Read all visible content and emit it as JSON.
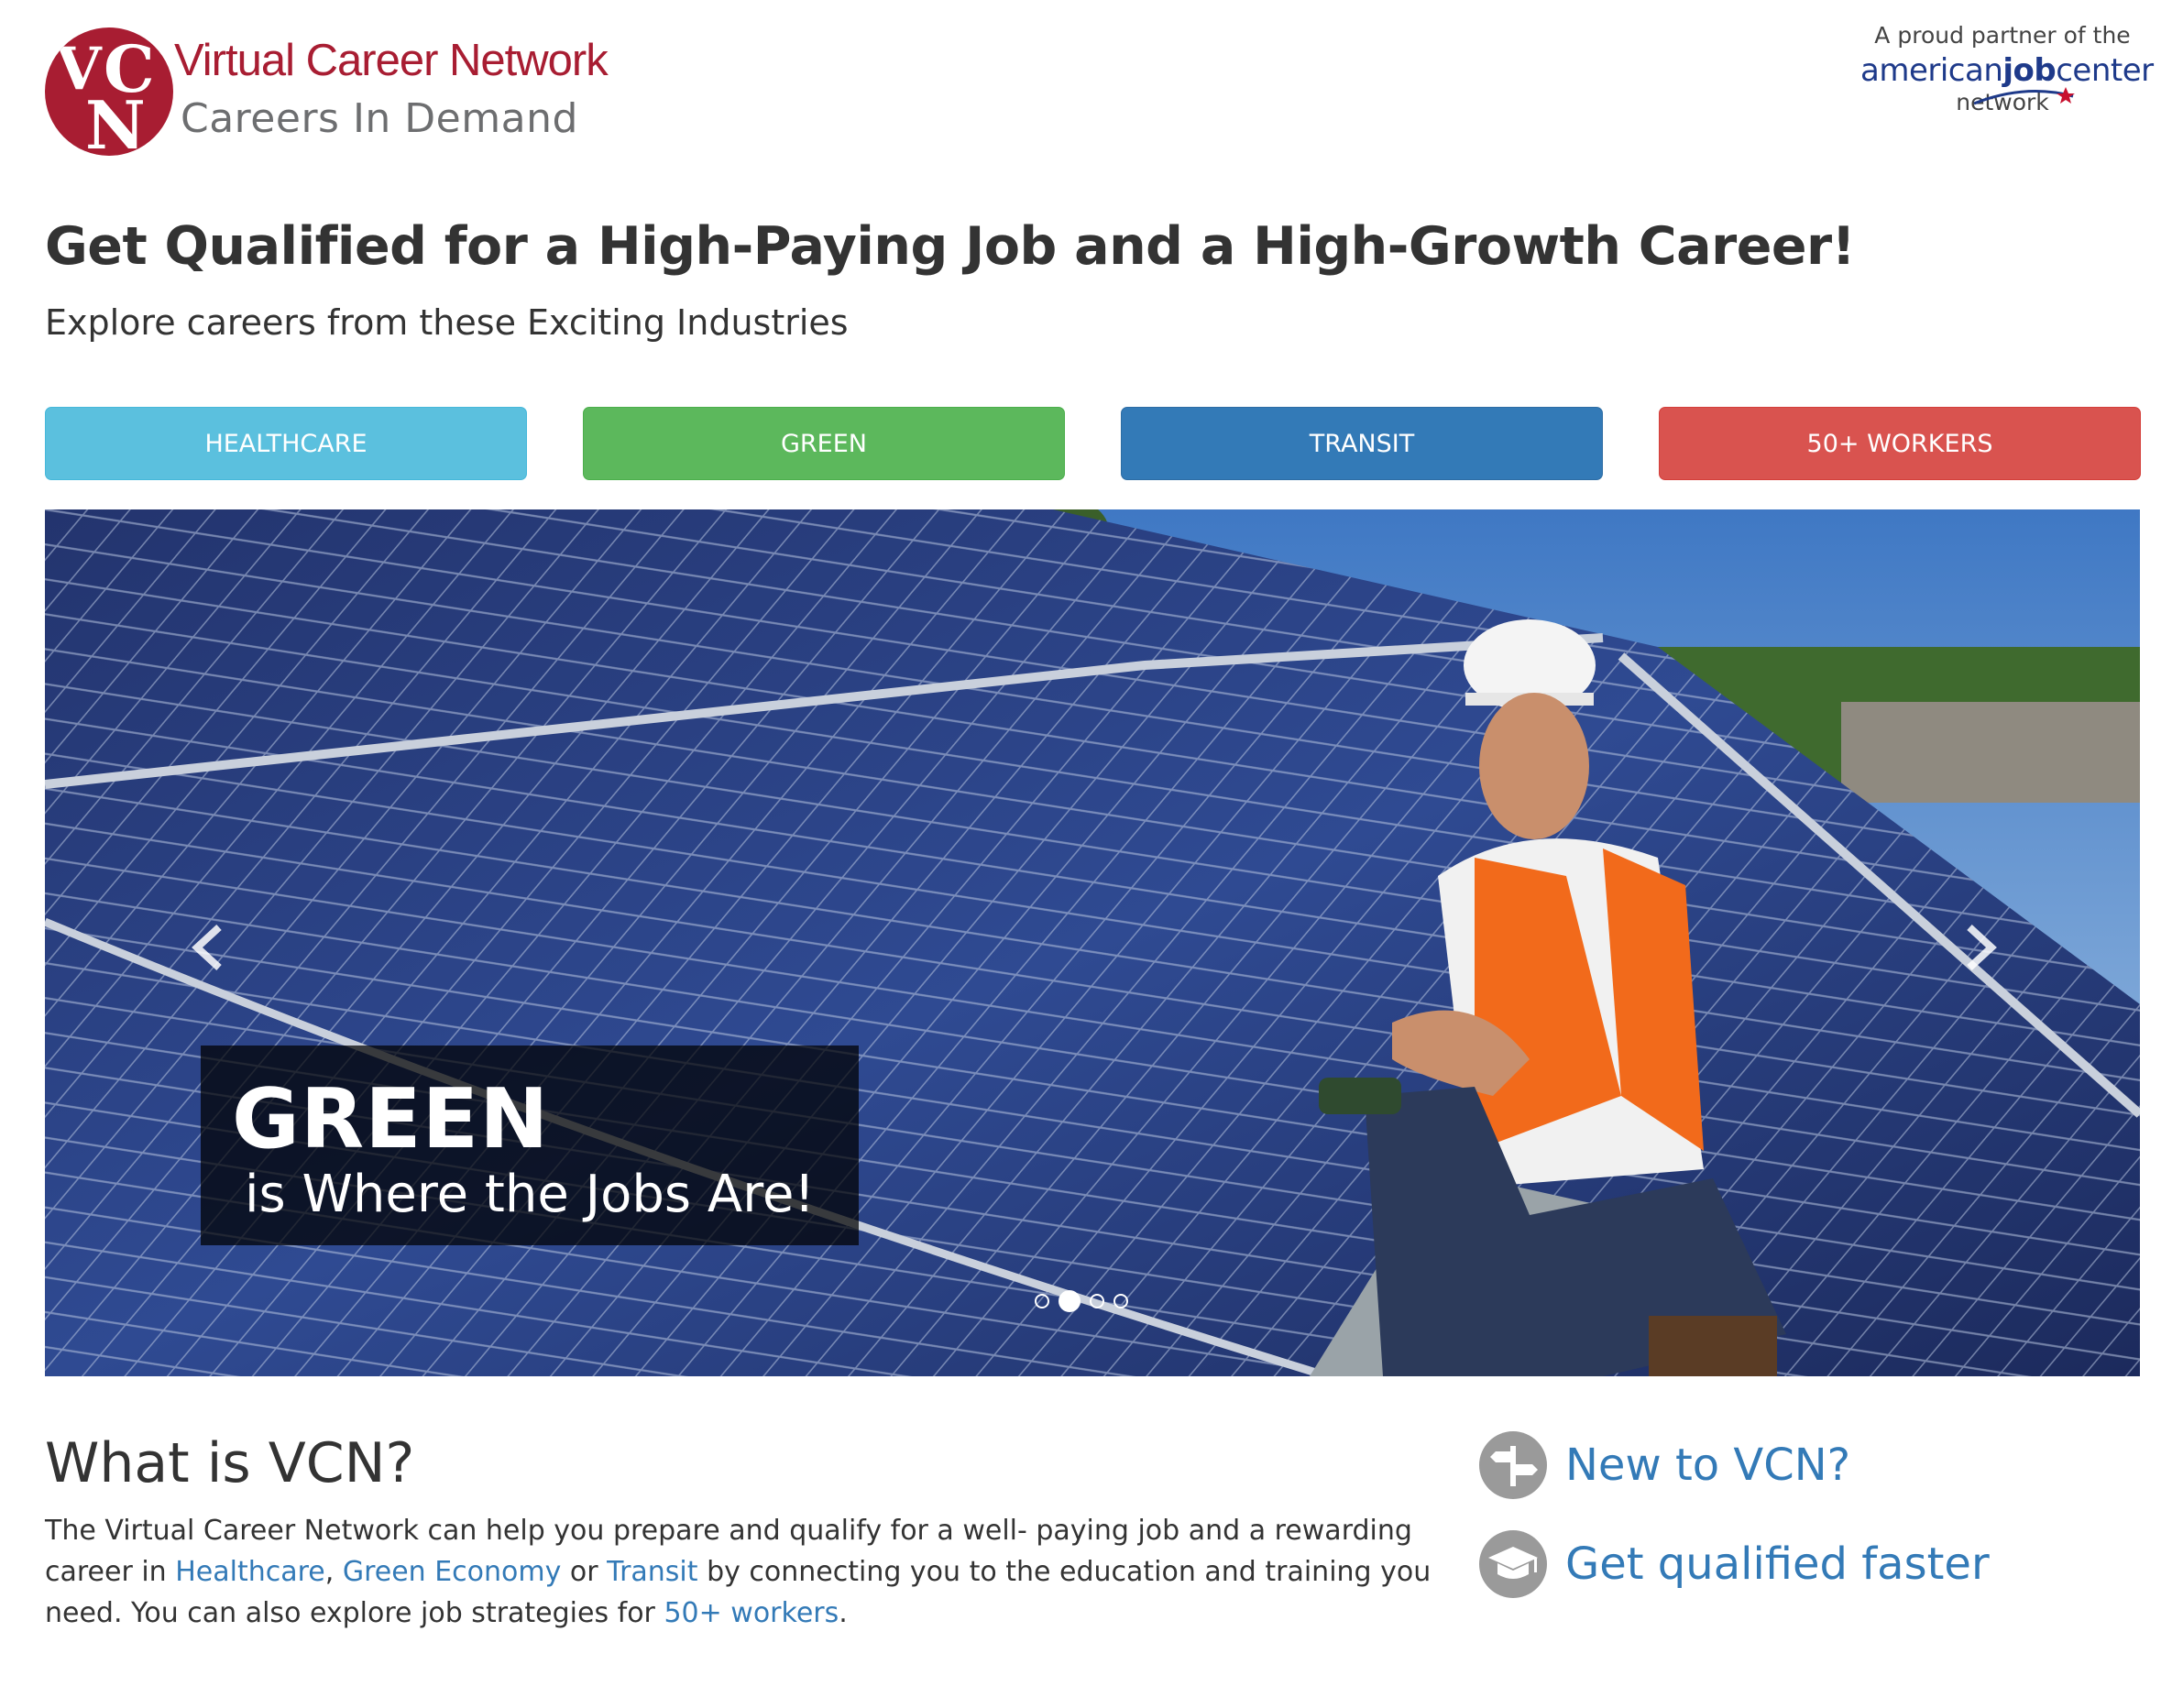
{
  "header": {
    "logo_letters": {
      "v": "V",
      "c": "C",
      "n": "N"
    },
    "logo_name": "Virtual Career Network",
    "logo_tagline": "Careers In Demand",
    "partner": {
      "line1": "A proud partner of the",
      "brand_part1": "american",
      "brand_part2": "job",
      "brand_part3": "center",
      "line3": "network"
    }
  },
  "hero": {
    "headline": "Get Qualified for a High-Paying Job and a High-Growth Career!",
    "subhead": "Explore careers from these Exciting Industries"
  },
  "industries": [
    {
      "label": "HEALTHCARE",
      "color": "#5bc0de"
    },
    {
      "label": "GREEN",
      "color": "#5cb85c"
    },
    {
      "label": "TRANSIT",
      "color": "#337ab7"
    },
    {
      "label": "50+ WORKERS",
      "color": "#d9534f"
    }
  ],
  "carousel": {
    "caption_title": "GREEN",
    "caption_sub": "is Where the Jobs Are!",
    "slide_count": 4,
    "active_slide": 2
  },
  "about": {
    "title": "What is VCN?",
    "text_1": "The Virtual Career Network can help you prepare and qualify for a well- paying job and a rewarding career in ",
    "link_healthcare": "Healthcare",
    "text_2": ", ",
    "link_green": "Green Economy",
    "text_3": " or ",
    "link_transit": "Transit",
    "text_4": " by connecting you to the education and training you need. You can also explore job strategies for ",
    "link_50": "50+ workers",
    "text_5": "."
  },
  "side_links": {
    "new_to_vcn": "New to VCN?",
    "get_qualified": "Get qualified faster"
  },
  "colors": {
    "brand_red": "#a81d32",
    "link_blue": "#337ab7",
    "icon_gray": "#9a9a9a"
  }
}
